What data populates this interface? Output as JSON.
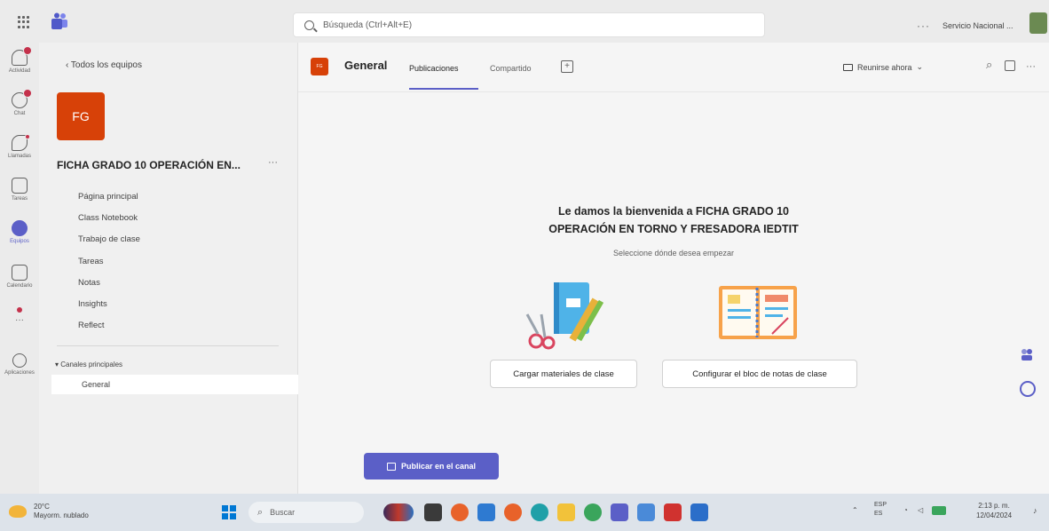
{
  "topbar": {
    "search_placeholder": "Búsqueda (Ctrl+Alt+E)",
    "more": "···",
    "org_name": "Servicio Nacional ..."
  },
  "rail": {
    "items": [
      {
        "label": "Actividad",
        "icon": "bell-icon"
      },
      {
        "label": "Chat",
        "icon": "chat-icon"
      },
      {
        "label": "Llamadas",
        "icon": "phone-icon"
      },
      {
        "label": "Tareas",
        "icon": "clipboard-icon"
      },
      {
        "label": "Equipos",
        "icon": "teams-icon"
      },
      {
        "label": "Calendario",
        "icon": "calendar-icon"
      },
      {
        "label": "···",
        "icon": "more-icon"
      },
      {
        "label": "Aplicaciones",
        "icon": "apps-icon"
      }
    ]
  },
  "teampane": {
    "back_link": "‹  Todos los equipos",
    "team_initials": "FG",
    "team_name": "FICHA GRADO 10 OPERACIÓN EN...",
    "team_more": "···",
    "nav": [
      "Página principal",
      "Class Notebook",
      "Trabajo de clase",
      "Tareas",
      "Notas",
      "Insights",
      "Reflect"
    ],
    "channels_header": "▾ Canales principales",
    "channel": "General"
  },
  "channel_header": {
    "avatar_initials": "FG",
    "title": "General",
    "tabs": [
      "Publicaciones",
      "Compartido"
    ],
    "add_tab": "+",
    "meet_label": "Reunirse ahora",
    "meet_chevron": "⌄",
    "search_icon": "⌕",
    "more": "···"
  },
  "main": {
    "welcome_line1": "Le damos la bienvenida a FICHA GRADO 10",
    "welcome_line2": "OPERACIÓN EN TORNO Y FRESADORA IEDTIT",
    "subtitle": "Seleccione dónde desea empezar",
    "card1": "Cargar materiales de clase",
    "card2": "Configurar el bloc de notas de clase",
    "post_button": "Publicar en el canal"
  },
  "taskbar": {
    "weather_temp": "20°C",
    "weather_desc": "Mayorm. nublado",
    "search": "Buscar",
    "lang_line1": "ESP",
    "lang_line2": "ES",
    "time": "2:13 p. m.",
    "date": "12/04/2024"
  },
  "colors": {
    "accent": "#5b5fc7",
    "team": "#d74108",
    "badge": "#c4314b"
  }
}
